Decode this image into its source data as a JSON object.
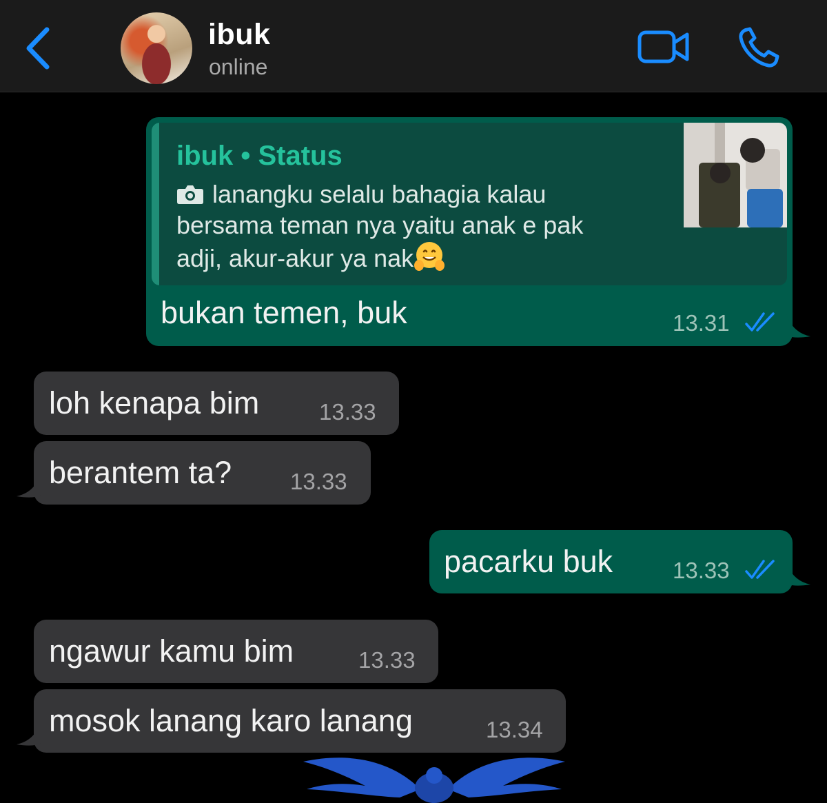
{
  "header": {
    "contact_name": "ibuk",
    "contact_status": "online"
  },
  "colors": {
    "accent_blue": "#1a8cff",
    "outgoing_bubble": "#005c4b",
    "incoming_bubble": "#363638",
    "quote_author": "#25c29c"
  },
  "messages": [
    {
      "direction": "outgoing",
      "quote": {
        "author": "ibuk • Status",
        "icon": "camera-icon",
        "text": "lanangku selalu bahagia kalau bersama teman nya yaitu anak e pak adji, akur-akur ya nak",
        "emoji": "hugging-face-emoji"
      },
      "text": "bukan temen, buk",
      "time": "13.31",
      "read": true
    },
    {
      "direction": "incoming",
      "text": "loh kenapa bim",
      "time": "13.33"
    },
    {
      "direction": "incoming",
      "text": "berantem ta?",
      "time": "13.33"
    },
    {
      "direction": "outgoing",
      "text": "pacarku buk",
      "time": "13.33",
      "read": true
    },
    {
      "direction": "incoming",
      "text": "ngawur kamu bim",
      "time": "13.33"
    },
    {
      "direction": "incoming",
      "text": "mosok lanang karo lanang",
      "time": "13.34"
    }
  ]
}
